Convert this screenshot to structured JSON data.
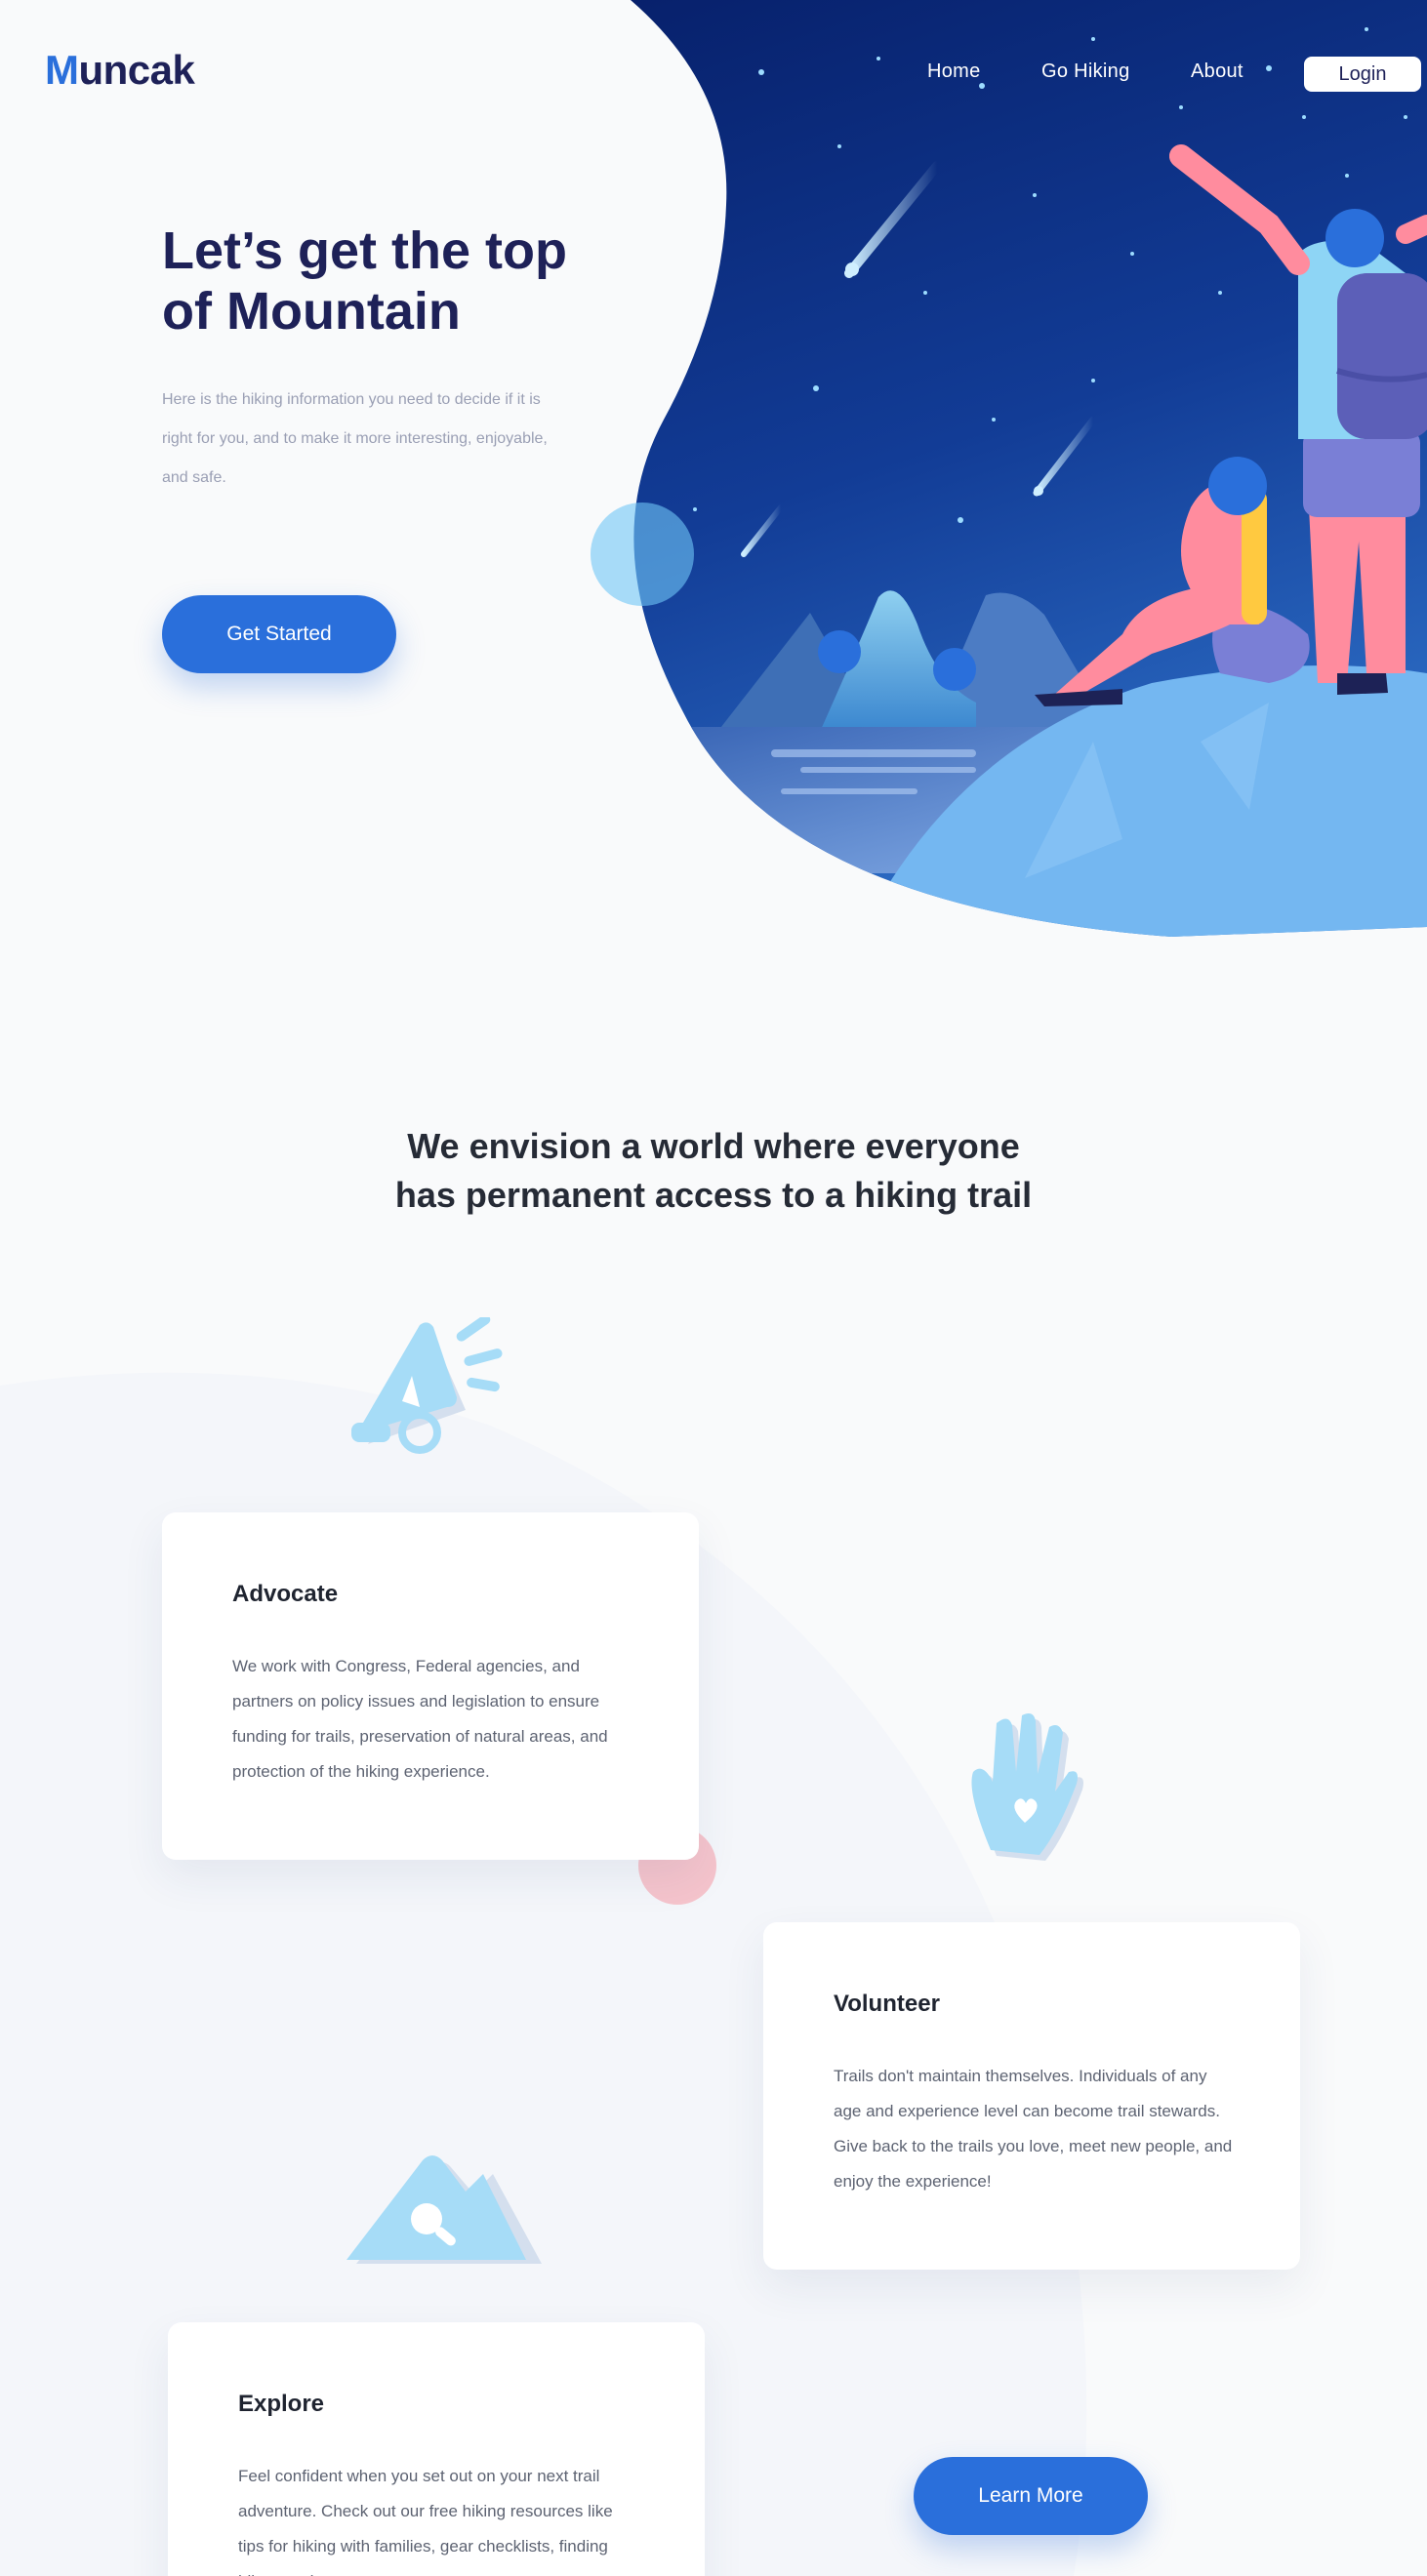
{
  "brand": {
    "logo_initial": "M",
    "logo_rest": "uncak"
  },
  "nav": {
    "items": [
      {
        "label": "Home"
      },
      {
        "label": "Go Hiking"
      },
      {
        "label": "About"
      }
    ],
    "login_label": "Login"
  },
  "hero": {
    "title_line1": "Let’s get the top",
    "title_line2": "of Mountain",
    "description": "Here is the hiking information you need to decide if it is right for you, and to make it more interesting, enjoyable, and safe.",
    "cta_label": "Get Started"
  },
  "vision": {
    "line1": "We envision a world  where everyone",
    "line2": "has permanent access to a hiking trail"
  },
  "features": [
    {
      "title": "Advocate",
      "text": "We work with Congress, Federal agencies, and partners on policy issues and legislation to ensure funding for trails, preservation of natural areas, and protection of the hiking experience.",
      "icon": "megaphone-icon"
    },
    {
      "title": "Volunteer",
      "text": "Trails don't maintain themselves. Individuals of any age and experience level can become trail stewards. Give back to the trails you love, meet new people, and enjoy the experience!",
      "icon": "hand-heart-icon"
    },
    {
      "title": "Explore",
      "text": "Feel confident when you set out on your next trail adventure. Check out our free hiking resources like tips for hiking with families, gear checklists, finding hikes, and more.",
      "icon": "mountain-search-icon"
    }
  ],
  "learn_more_label": "Learn More",
  "colors": {
    "accent": "#2a6fdb",
    "heading": "#1e2158",
    "night_sky": "#0d2a78",
    "background": "#f9fafb"
  }
}
